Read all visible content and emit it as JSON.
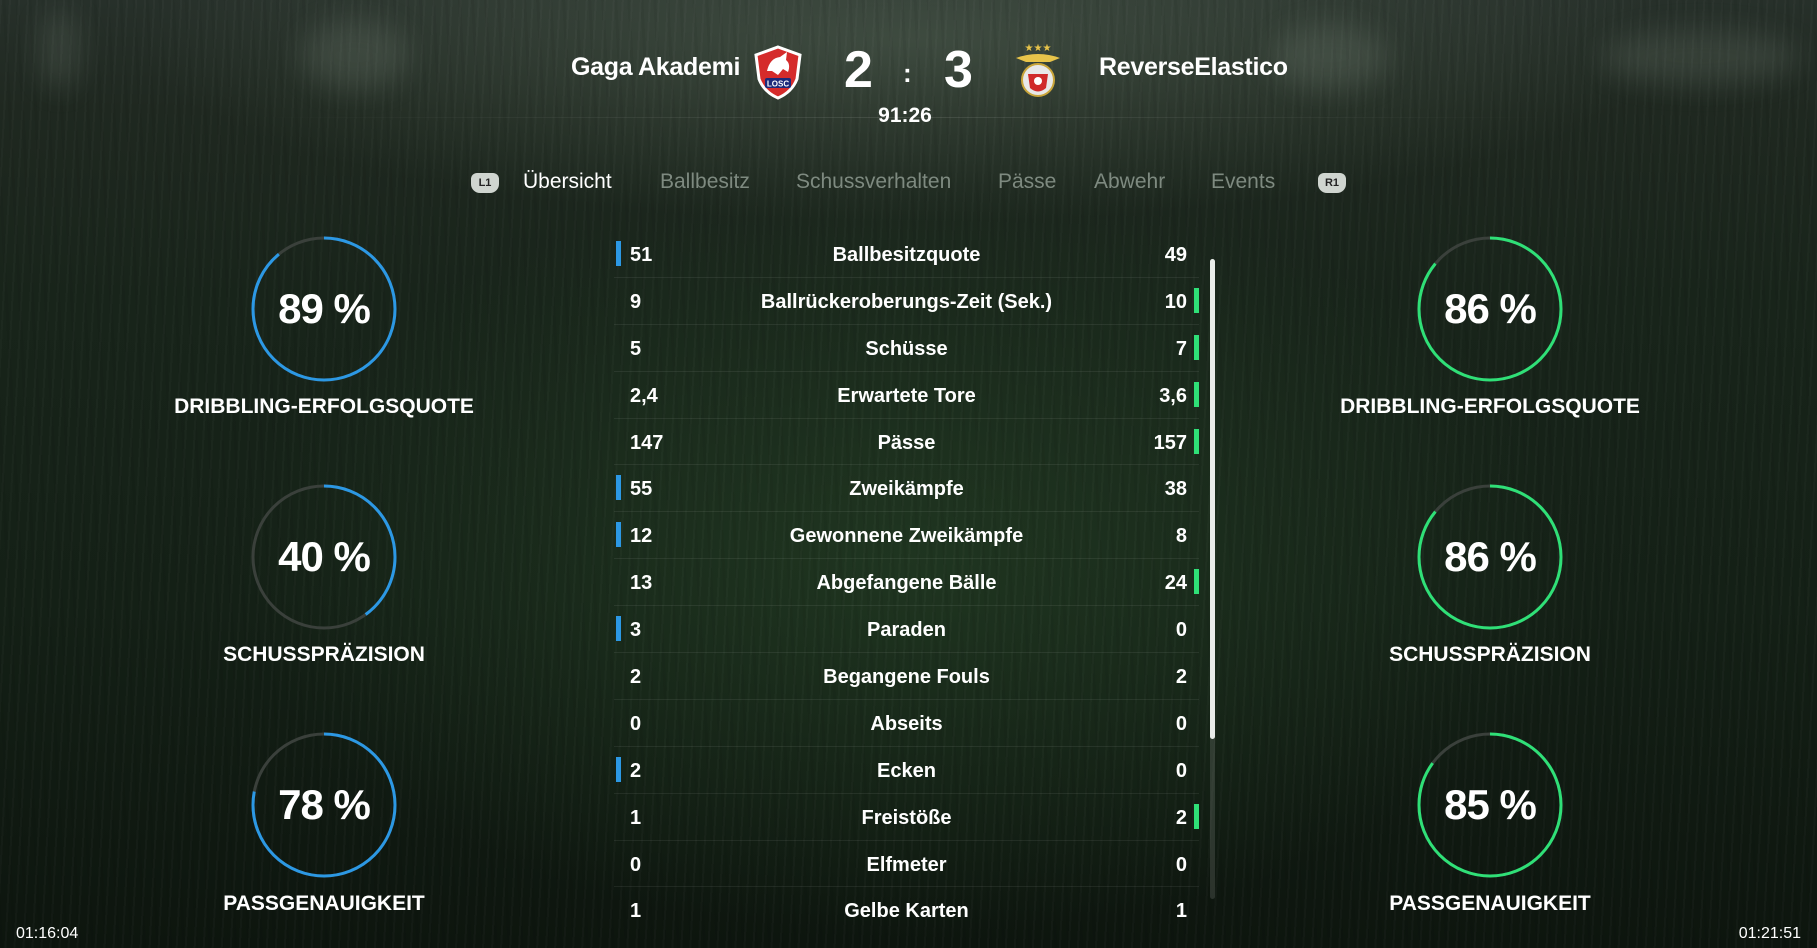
{
  "match": {
    "home_team": "Gaga Akademi",
    "away_team": "ReverseElastico",
    "home_score": "2",
    "away_score": "3",
    "score_separator": ":",
    "match_clock": "91:26",
    "home_badge_text": "LOSC"
  },
  "tabs": {
    "left_bumper": "L1",
    "right_bumper": "R1",
    "items": [
      "Übersicht",
      "Ballbesitz",
      "Schussverhalten",
      "Pässe",
      "Abwehr",
      "Events"
    ],
    "active": "Übersicht"
  },
  "home_rings": [
    {
      "value": "89 %",
      "percent": 89,
      "label": "DRIBBLING-ERFOLGSQUOTE"
    },
    {
      "value": "40 %",
      "percent": 40,
      "label": "SCHUSSPRÄZISION"
    },
    {
      "value": "78 %",
      "percent": 78,
      "label": "PASSGENAUIGKEIT"
    }
  ],
  "away_rings": [
    {
      "value": "86 %",
      "percent": 86,
      "label": "DRIBBLING-ERFOLGSQUOTE"
    },
    {
      "value": "86 %",
      "percent": 86,
      "label": "SCHUSSPRÄZISION"
    },
    {
      "value": "85 %",
      "percent": 85,
      "label": "PASSGENAUIGKEIT"
    }
  ],
  "stats": [
    {
      "left": "51",
      "label": "Ballbesitzquote",
      "right": "49",
      "leader": "home"
    },
    {
      "left": "9",
      "label": "Ballrückeroberungs-Zeit (Sek.)",
      "right": "10",
      "leader": "away"
    },
    {
      "left": "5",
      "label": "Schüsse",
      "right": "7",
      "leader": "away"
    },
    {
      "left": "2,4",
      "label": "Erwartete Tore",
      "right": "3,6",
      "leader": "away"
    },
    {
      "left": "147",
      "label": "Pässe",
      "right": "157",
      "leader": "away"
    },
    {
      "left": "55",
      "label": "Zweikämpfe",
      "right": "38",
      "leader": "home"
    },
    {
      "left": "12",
      "label": "Gewonnene Zweikämpfe",
      "right": "8",
      "leader": "home"
    },
    {
      "left": "13",
      "label": "Abgefangene Bälle",
      "right": "24",
      "leader": "away"
    },
    {
      "left": "3",
      "label": "Paraden",
      "right": "0",
      "leader": "home"
    },
    {
      "left": "2",
      "label": "Begangene Fouls",
      "right": "2",
      "leader": "none"
    },
    {
      "left": "0",
      "label": "Abseits",
      "right": "0",
      "leader": "none"
    },
    {
      "left": "2",
      "label": "Ecken",
      "right": "0",
      "leader": "home"
    },
    {
      "left": "1",
      "label": "Freistöße",
      "right": "2",
      "leader": "away"
    },
    {
      "left": "0",
      "label": "Elfmeter",
      "right": "0",
      "leader": "none"
    },
    {
      "left": "1",
      "label": "Gelbe Karten",
      "right": "1",
      "leader": "none"
    }
  ],
  "video": {
    "elapsed": "01:16:04",
    "total": "01:21:51"
  },
  "colors": {
    "home_accent": "#2c98e4",
    "away_accent": "#2fe077",
    "ring_track": "#3a403b"
  },
  "icons": {
    "home_crest": "losc-crest-icon",
    "away_crest": "benfica-crest-icon"
  }
}
